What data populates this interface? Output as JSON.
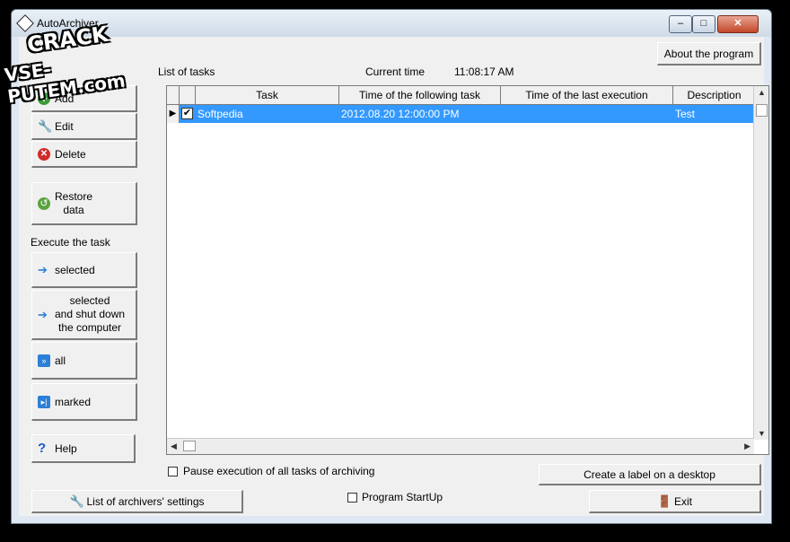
{
  "window": {
    "title": "AutoArchiver"
  },
  "watermark": {
    "line1": "CRACK",
    "line2": "VSE-PUTEM.com"
  },
  "top": {
    "list_of_tasks": "List of tasks",
    "current_time_label": "Current time",
    "current_time_value": "11:08:17 AM",
    "about_label": "About the program"
  },
  "sidebar": {
    "add": "Add",
    "edit": "Edit",
    "delete": "Delete",
    "restore_line1": "Restore",
    "restore_line2": "data",
    "execute_label": "Execute the task",
    "selected": "selected",
    "shutdown_line1": "selected",
    "shutdown_line2": "and shut down",
    "shutdown_line3": "the computer",
    "all": "all",
    "marked": "marked",
    "help": "Help"
  },
  "grid": {
    "columns": [
      "Task",
      "Time of the following task",
      "Time of the last execution",
      "Description"
    ],
    "rows": [
      {
        "checked": "✔",
        "task": "Softpedia",
        "next": "2012.08.20 12:00:00 PM",
        "last": "",
        "desc": "Test"
      }
    ]
  },
  "bottom": {
    "pause_label": "Pause execution of all tasks of archiving",
    "startup_label": "Program StartUp",
    "archivers_settings": "List of archivers' settings",
    "create_label": "Create a label on a desktop",
    "exit": "Exit"
  }
}
